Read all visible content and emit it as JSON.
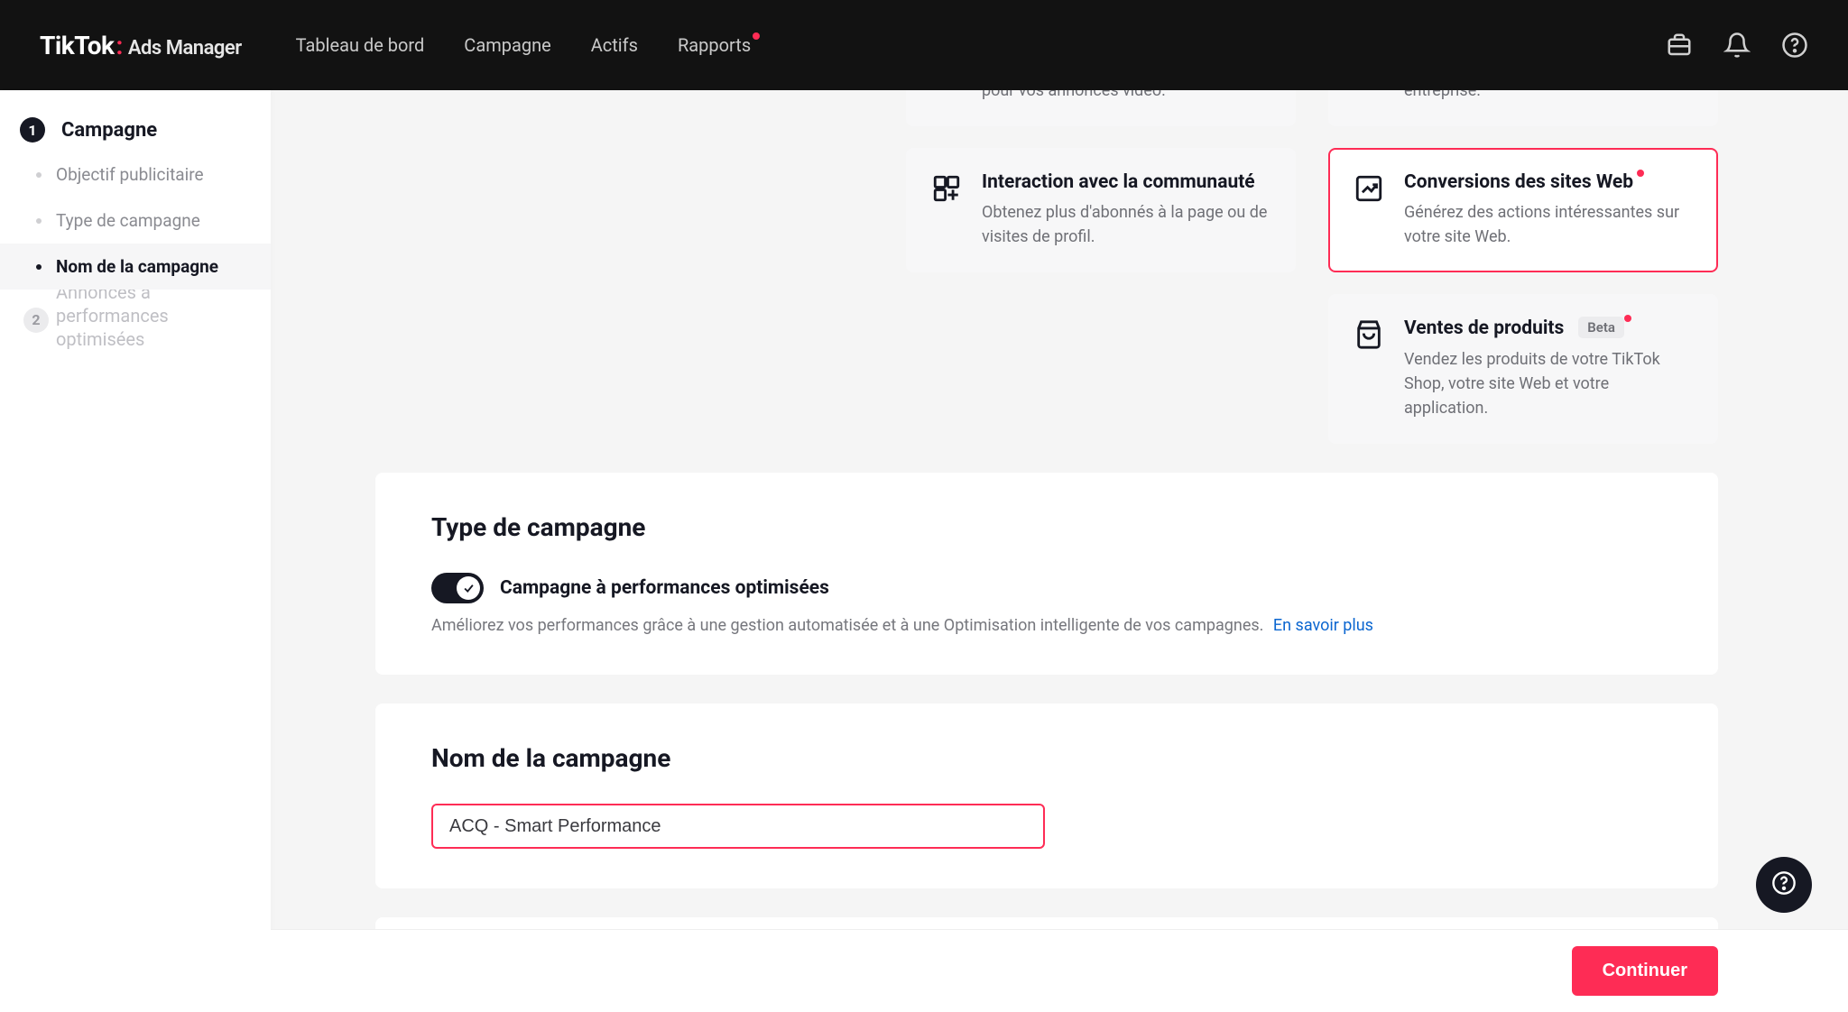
{
  "brand": {
    "name": "TikTok",
    "product": "Ads Manager"
  },
  "nav": {
    "items": [
      {
        "label": "Tableau de bord",
        "has_dot": false
      },
      {
        "label": "Campagne",
        "has_dot": false
      },
      {
        "label": "Actifs",
        "has_dot": false
      },
      {
        "label": "Rapports",
        "has_dot": true
      }
    ]
  },
  "sidebar": {
    "step1_number": "1",
    "step1_label": "Campagne",
    "substeps": [
      {
        "label": "Objectif publicitaire",
        "active": false
      },
      {
        "label": "Type de campagne",
        "active": false
      },
      {
        "label": "Nom de la campagne",
        "active": true
      }
    ],
    "step2_number": "2",
    "step2_cut_text": "Annonces à performances optimisées"
  },
  "objectives": {
    "col_a": [
      {
        "cut": true,
        "icon": "video",
        "title": "",
        "desc": "Obtenez plus de vues et d'engagement pour vos annonces vidéo."
      },
      {
        "icon": "community",
        "title": "Interaction avec la communauté",
        "desc": "Obtenez plus d'abonnés à la page ou de visites de profil."
      }
    ],
    "col_b": [
      {
        "cut": true,
        "icon": "leads",
        "title": "",
        "desc": "Obtenez des prospects pour votre entreprise."
      },
      {
        "icon": "web-conversion",
        "title": "Conversions des sites Web",
        "desc": "Générez des actions intéressantes sur votre site Web.",
        "selected": true,
        "dot": true
      },
      {
        "icon": "product-sales",
        "title": "Ventes de produits",
        "badge": "Beta",
        "desc": "Vendez les produits de votre TikTok Shop, votre site Web et votre application.",
        "dot": true
      }
    ]
  },
  "panels": {
    "campaign_type": {
      "heading": "Type de campagne",
      "toggle_label": "Campagne à performances optimisées",
      "toggle_on": true,
      "desc": "Améliorez vos performances grâce à une gestion automatisée et à une Optimisation intelligente de vos campagnes.",
      "learn_more": "En savoir plus"
    },
    "campaign_name": {
      "heading": "Nom de la campagne",
      "value": "ACQ - Smart Performance "
    }
  },
  "footer": {
    "continue_label": "Continuer"
  }
}
